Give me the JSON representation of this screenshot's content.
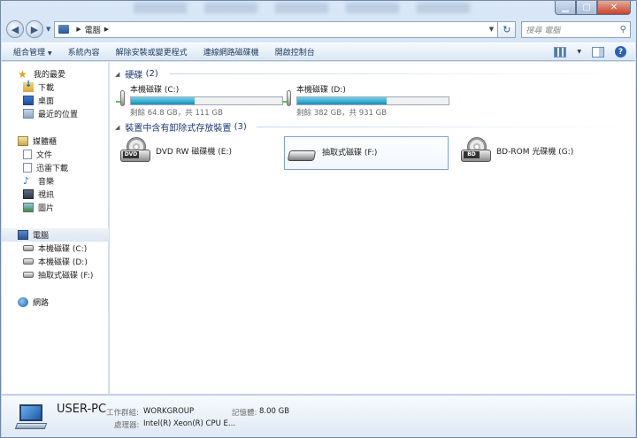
{
  "address": {
    "crumbs": [
      "電腦"
    ]
  },
  "search": {
    "placeholder": "搜尋 電腦"
  },
  "toolbar": {
    "items": [
      "組合管理",
      "系統內容",
      "解除安裝或變更程式",
      "連線網路磁碟機",
      "開啟控制台"
    ]
  },
  "sidebar": {
    "favorites": {
      "label": "我的最愛",
      "items": [
        "下載",
        "桌面",
        "最近的位置"
      ]
    },
    "libraries": {
      "label": "媒體櫃",
      "items": [
        "文件",
        "迅雷下載",
        "音樂",
        "視訊",
        "圖片"
      ]
    },
    "computer": {
      "label": "電腦",
      "items": [
        "本機磁碟 (C:)",
        "本機磁碟 (D:)",
        "抽取式磁碟 (F:)"
      ]
    },
    "network": {
      "label": "網路"
    }
  },
  "main": {
    "hdd_group": {
      "title": "硬碟",
      "count": "(2)"
    },
    "drives": [
      {
        "name": "本機磁碟 (C:)",
        "status": "剩餘 64.8 GB，共 111 GB",
        "used_fraction": 0.42
      },
      {
        "name": "本機磁碟 (D:)",
        "status": "剩餘 382 GB，共 931 GB",
        "used_fraction": 0.59
      }
    ],
    "removable_group": {
      "title": "裝置中含有卸除式存放裝置",
      "count": "(3)"
    },
    "removable": [
      {
        "name": "DVD RW 磁碟機 (E:)",
        "disc_label": "DVD"
      },
      {
        "name": "抽取式磁碟 (F:)"
      },
      {
        "name": "BD-ROM 光碟機 (G:)",
        "disc_label": "BD"
      }
    ]
  },
  "details": {
    "pc_name": "USER-PC",
    "workgroup_label": "工作群組:",
    "workgroup": "WORKGROUP",
    "memory_label": "記憶體:",
    "memory": "8.00 GB",
    "processor_label": "處理器:",
    "processor": "Intel(R) Xeon(R) CPU E..."
  },
  "colors": {
    "accent": "#1a8eb8",
    "header_text": "#1e3a7a"
  }
}
